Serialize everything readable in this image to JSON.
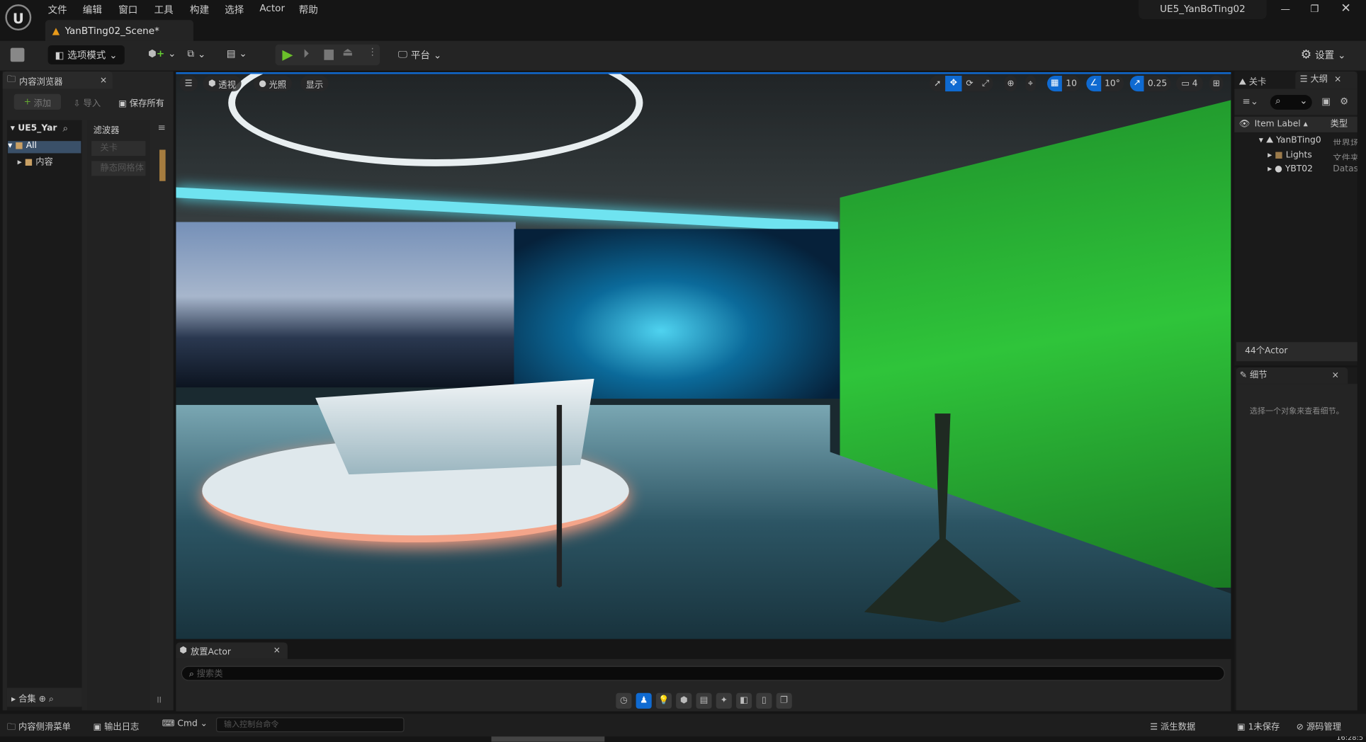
{
  "menu": [
    "文件",
    "编辑",
    "窗口",
    "工具",
    "构建",
    "选择",
    "Actor",
    "帮助"
  ],
  "project_title": "UE5_YanBoTing02",
  "level_tab": "YanBTing02_Scene*",
  "toolbar": {
    "mode": "选项模式",
    "platform": "平台",
    "settings": "设置"
  },
  "viewport": {
    "perspective": "透视",
    "lighting": "光照",
    "show": "显示",
    "grid_snap": "10",
    "rotation_snap": "10°",
    "scale_snap": "0.25",
    "camera_speed": "4"
  },
  "content_browser": {
    "title": "内容浏览器",
    "add": "添加",
    "import": "导入",
    "save_all": "保存所有",
    "root": "UE5_Yar",
    "tree": [
      "All",
      "内容"
    ],
    "filters_title": "滤波器",
    "filters": [
      "关卡",
      "静态网格体"
    ],
    "collections": "合集"
  },
  "place_actor": {
    "title": "放置Actor",
    "search_placeholder": "搜索类"
  },
  "outliner": {
    "tab_levels": "关卡",
    "tab_outliner": "大纲",
    "col_label": "Item Label",
    "col_type": "类型",
    "items": [
      {
        "label": "YanBTing0",
        "type": "世界场"
      },
      {
        "label": "Lights",
        "type": "文件夹"
      },
      {
        "label": "YBT02",
        "type": "Datas"
      }
    ],
    "count": "44个Actor"
  },
  "details": {
    "title": "细节",
    "empty": "选择一个对象来查看细节。"
  },
  "statusbar": {
    "content_drawer": "内容侧滑菜单",
    "output_log": "输出日志",
    "cmd": "Cmd",
    "cmd_placeholder": "输入控制台命令",
    "derived_data": "派生数据",
    "unsaved": "1未保存",
    "source_control": "源码管理",
    "clock": "16:28:5"
  }
}
